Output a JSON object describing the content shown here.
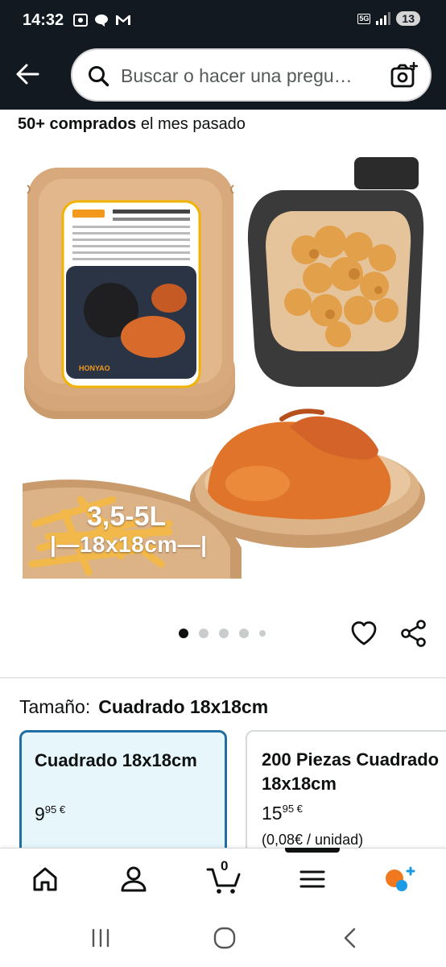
{
  "status_bar": {
    "time": "14:32",
    "network_badge": "5G",
    "battery": "13"
  },
  "search": {
    "placeholder": "Buscar o hacer una pregu…"
  },
  "purchased": {
    "count_bold": "50+ comprados",
    "suffix": " el mes pasado"
  },
  "product_image": {
    "overlay_capacity": "3,5-5L",
    "overlay_size": "|—18x18cm—|",
    "brand_label": "HONYAO",
    "package_text": "Food grade Non-leaking Non-stick"
  },
  "carousel": {
    "dot_count": 5,
    "active_index": 0
  },
  "size_selector": {
    "label": "Tamaño:",
    "selected_value": "Cuadrado 18x18cm",
    "options": [
      {
        "title": "Cuadrado 18x18cm",
        "price_whole": "9",
        "price_fraction": "95 €"
      },
      {
        "title_line1": "200 Piezas Cuadrado",
        "title_line2": "18x18cm",
        "price_whole": "15",
        "price_fraction": "95 €",
        "unit_price": "(0,08€ / unidad)"
      }
    ]
  },
  "bottom_nav": {
    "cart_count": "0"
  },
  "colors": {
    "header_bg": "#131921",
    "selected_border": "#1f6fa4",
    "selected_bg": "#e6f6fb",
    "rufus_orange": "#f0781e",
    "rufus_blue": "#1a9be6"
  }
}
